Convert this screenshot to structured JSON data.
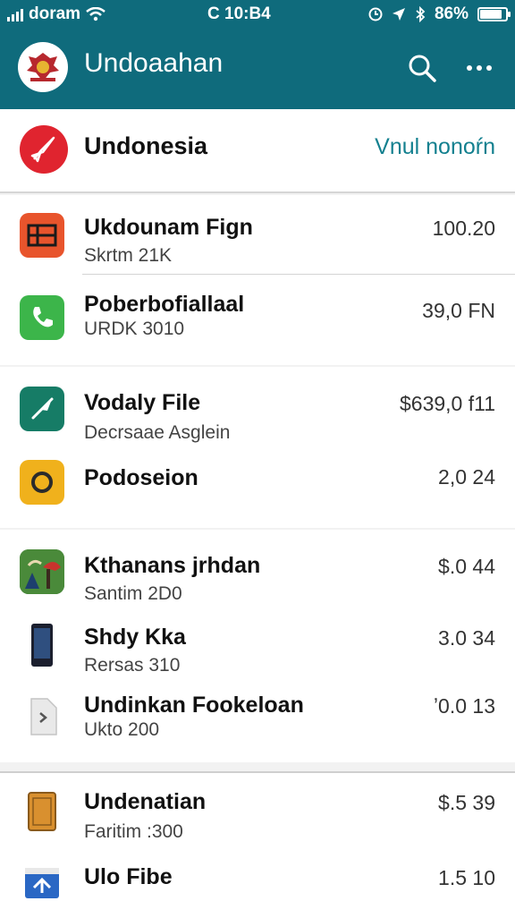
{
  "status": {
    "carrier": "doram",
    "time": "C 10:B4",
    "battery": "86%",
    "battery_level": 0.86
  },
  "appbar": {
    "title": "Undoaahan",
    "icons": [
      "emblem-logo",
      "search-icon",
      "more-icon"
    ]
  },
  "header": {
    "title": "Undonesia",
    "action": "Vnul nonoŕn"
  },
  "items": [
    {
      "title": "Ukdounam Fign",
      "subtitle": "Skrtm 21K",
      "value": "100.20",
      "icon": "keyboard-icon",
      "color": "#e8542c"
    },
    {
      "title": "Poberbofiallaal",
      "subtitle": "URDK 3010",
      "value": "39,0 FN",
      "icon": "phone-icon",
      "color": "#3cb54a"
    },
    {
      "title": "Vodaly File",
      "subtitle": "Decrsaae Asglein",
      "value": "$639,0 f11",
      "icon": "send-icon",
      "color": "#167c66"
    },
    {
      "title": "Podoseion",
      "subtitle": "",
      "value": "2,0 24",
      "icon": "camera-icon",
      "color": "#f0b11c"
    },
    {
      "title": "Kthanans jrhdan",
      "subtitle": "Santim 2D0",
      "value": "$.0 44",
      "icon": "game-icon",
      "color": "#2f6e2a"
    },
    {
      "title": "Shdy Kka",
      "subtitle": "Rersas 310",
      "value": "3.0 34",
      "icon": "device-icon",
      "color": "#1b1f2e"
    },
    {
      "title": "Undinkan Fookeloan",
      "subtitle": "Ukto 200",
      "value": "ʼ0.0 13",
      "icon": "file-icon",
      "color": "#e9e9e9"
    },
    {
      "title": "Undenatian",
      "subtitle": "Faritim :300",
      "value": "$.5 39",
      "icon": "book-icon",
      "color": "#d9902f"
    },
    {
      "title": "Ulo Fibe",
      "subtitle": "",
      "value": "1.5 10",
      "icon": "upload-icon",
      "color": "#2a67c4"
    }
  ]
}
